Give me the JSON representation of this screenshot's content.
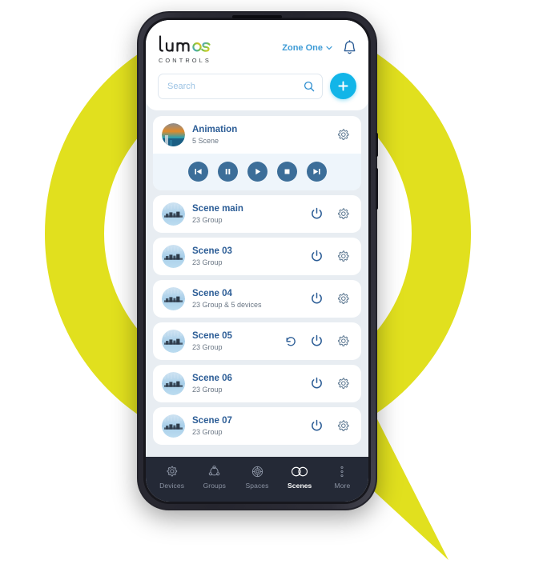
{
  "background": {
    "shape_name": "speech-bubble",
    "bubble_color": "#e1e01e",
    "inner_circle_color": "#ffffff",
    "page_background": "#ffffff"
  },
  "device": {
    "name": "smartphone-mockup",
    "frame_color": "#2a2a33",
    "screen_background": "#e8edf2"
  },
  "colors": {
    "accent_cyan": "#12b5e8",
    "title_blue": "#2c5d96",
    "zone_blue": "#3e9bd6",
    "media_blue": "#3c6e99",
    "nav_dark": "#242936",
    "card_white": "#ffffff",
    "media_bar_bg": "#eef5fb"
  },
  "header": {
    "logo_text": "lumos",
    "logo_subtext": "CONTROLS",
    "zone_label": "Zone One",
    "chevron_icon": "chevron-down-icon",
    "bell_icon": "bell-icon"
  },
  "search": {
    "value": "",
    "placeholder": "Search",
    "search_icon": "search-icon",
    "add_label": "+",
    "add_icon": "plus-icon"
  },
  "animation_card": {
    "title": "Animation",
    "subtitle": "5 Scene",
    "thumbnail": "animation-thumbnail",
    "settings_icon": "gear-icon",
    "media_controls": [
      {
        "name": "previous-button",
        "icon": "skip-previous-icon"
      },
      {
        "name": "pause-button",
        "icon": "pause-icon"
      },
      {
        "name": "play-button",
        "icon": "play-icon"
      },
      {
        "name": "stop-button",
        "icon": "stop-icon"
      },
      {
        "name": "next-button",
        "icon": "skip-next-icon"
      }
    ]
  },
  "scenes": [
    {
      "title": "Scene main",
      "subtitle": "23 Group",
      "has_restore": false,
      "power_icon": "power-icon",
      "settings_icon": "gear-icon"
    },
    {
      "title": "Scene 03",
      "subtitle": "23 Group",
      "has_restore": false,
      "power_icon": "power-icon",
      "settings_icon": "gear-icon"
    },
    {
      "title": "Scene 04",
      "subtitle": "23 Group & 5 devices",
      "has_restore": false,
      "power_icon": "power-icon",
      "settings_icon": "gear-icon"
    },
    {
      "title": "Scene 05",
      "subtitle": "23 Group",
      "has_restore": true,
      "restore_icon": "restore-rotate-ccw-icon",
      "power_icon": "power-icon",
      "settings_icon": "gear-icon"
    },
    {
      "title": "Scene 06",
      "subtitle": "23 Group",
      "has_restore": false,
      "power_icon": "power-icon",
      "settings_icon": "gear-icon"
    },
    {
      "title": "Scene 07",
      "subtitle": "23 Group",
      "has_restore": false,
      "power_icon": "power-icon",
      "settings_icon": "gear-icon"
    }
  ],
  "bottom_nav": {
    "items": [
      {
        "label": "Devices",
        "icon": "gear-device-icon",
        "active": false
      },
      {
        "label": "Groups",
        "icon": "nodes-group-icon",
        "active": false
      },
      {
        "label": "Spaces",
        "icon": "layered-circles-icon",
        "active": false
      },
      {
        "label": "Scenes",
        "icon": "two-circles-icon",
        "active": true
      },
      {
        "label": "More",
        "icon": "vertical-dots-icon",
        "active": false
      }
    ]
  }
}
